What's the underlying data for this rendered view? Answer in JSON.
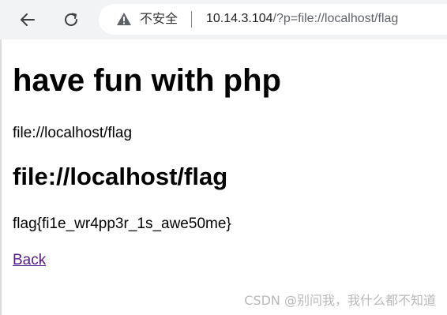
{
  "browser": {
    "security_label": "不安全",
    "url_host": "10.14.3.104",
    "url_rest": "/?p=file://localhost/flag",
    "icons": {
      "back": "arrow-left-icon",
      "reload": "reload-icon",
      "security": "warning-triangle-icon"
    }
  },
  "page": {
    "title": "have fun with php",
    "echo_value": "file://localhost/flag",
    "subtitle": "file://localhost/flag",
    "flag": "flag{fi1e_wr4pp3r_1s_awe50me}",
    "back_link": "Back"
  },
  "watermark": "CSDN @别问我，我什么都不知道",
  "colors": {
    "toolbar_bg": "#f1f3f4",
    "link_visited": "#551a8b",
    "text": "#000000"
  }
}
